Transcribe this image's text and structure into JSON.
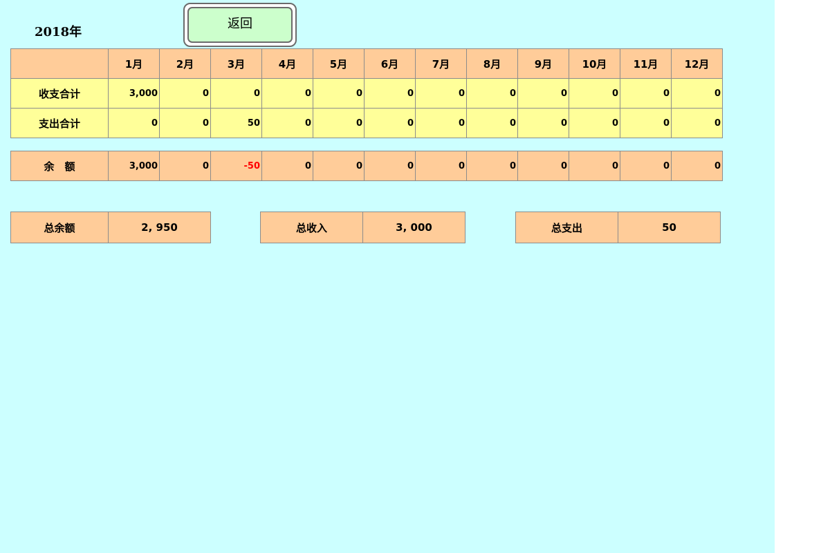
{
  "year_title": "2018年",
  "back_button": "返回",
  "months": [
    "1月",
    "2月",
    "3月",
    "4月",
    "5月",
    "6月",
    "7月",
    "8月",
    "9月",
    "10月",
    "11月",
    "12月"
  ],
  "rows": [
    {
      "label": "收支合计",
      "values": [
        "3,000",
        "0",
        "0",
        "0",
        "0",
        "0",
        "0",
        "0",
        "0",
        "0",
        "0",
        "0"
      ]
    },
    {
      "label": "支出合计",
      "values": [
        "0",
        "0",
        "50",
        "0",
        "0",
        "0",
        "0",
        "0",
        "0",
        "0",
        "0",
        "0"
      ]
    }
  ],
  "balance_row": {
    "label": "余　额",
    "values": [
      "3,000",
      "0",
      "-50",
      "0",
      "0",
      "0",
      "0",
      "0",
      "0",
      "0",
      "0",
      "0"
    ]
  },
  "summary": {
    "total_balance_label": "总余额",
    "total_balance_value": "2, 950",
    "total_income_label": "总收入",
    "total_income_value": "3, 000",
    "total_expense_label": "总支出",
    "total_expense_value": "50"
  },
  "colors": {
    "background": "#ccffff",
    "header": "#ffcc99",
    "data_rows": "#ffff99",
    "button": "#ccffcc",
    "negative": "#ff0000"
  }
}
